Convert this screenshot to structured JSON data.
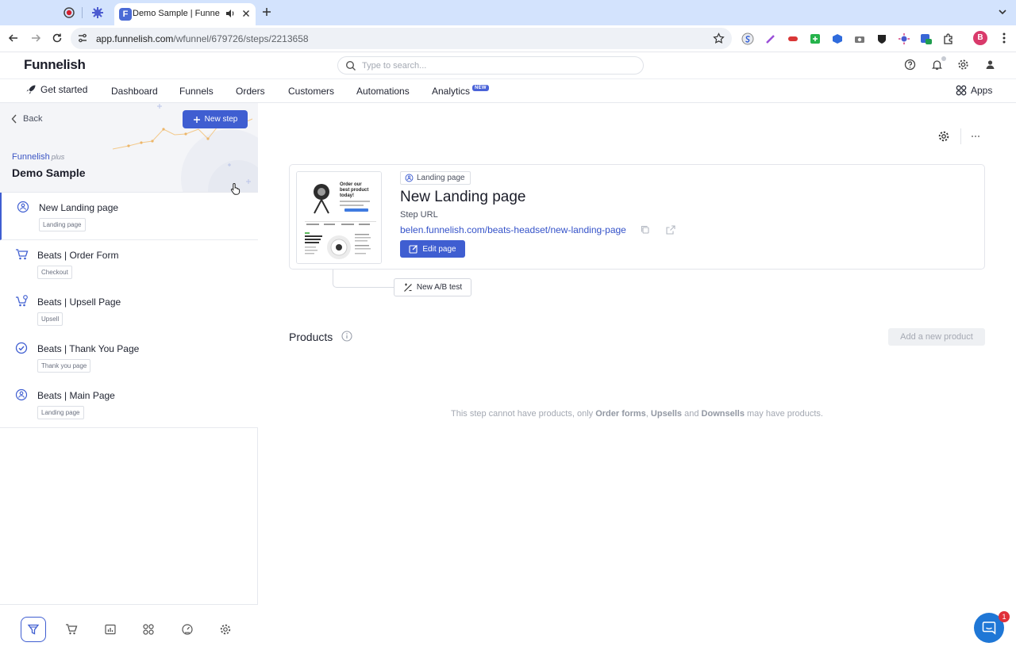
{
  "browser": {
    "active_tab_title": "Demo Sample | Funnelish",
    "url_host": "app.funnelish.com",
    "url_path": "/wfunnel/679726/steps/2213658",
    "profile_initial": "B"
  },
  "header": {
    "logo": "Funnelish",
    "search_placeholder": "Type to search..."
  },
  "nav": {
    "get_started": "Get started",
    "dashboard": "Dashboard",
    "funnels": "Funnels",
    "orders": "Orders",
    "customers": "Customers",
    "automations": "Automations",
    "analytics": "Analytics",
    "analytics_badge": "NEW",
    "apps": "Apps"
  },
  "sidebar": {
    "back": "Back",
    "new_step": "New step",
    "brand": "Funnelish",
    "plan": "plus",
    "funnel_name": "Demo Sample",
    "steps": [
      {
        "title": "New Landing page",
        "tag": "Landing page",
        "icon": "landing-page-icon"
      },
      {
        "title": "Beats | Order Form",
        "tag": "Checkout",
        "icon": "cart-icon"
      },
      {
        "title": "Beats | Upsell Page",
        "tag": "Upsell",
        "icon": "cart-plus-icon"
      },
      {
        "title": "Beats | Thank You Page",
        "tag": "Thank you page",
        "icon": "check-circle-icon"
      },
      {
        "title": "Beats | Main Page",
        "tag": "Landing page",
        "icon": "landing-page-icon"
      }
    ]
  },
  "step_card": {
    "type": "Landing page",
    "title": "New Landing page",
    "url_label": "Step URL",
    "url": "belen.funnelish.com/beats-headset/new-landing-page",
    "edit_button": "Edit page",
    "ab_test_button": "New A/B test",
    "thumb_headline": "Order our best product today!"
  },
  "products": {
    "title": "Products",
    "add_button": "Add a new product",
    "empty_pre": "This step cannot have products, only ",
    "empty_b1": "Order forms",
    "empty_mid1": ", ",
    "empty_b2": "Upsells",
    "empty_mid2": " and ",
    "empty_b3": "Downsells",
    "empty_post": " may have products."
  },
  "chat": {
    "badge": "1"
  },
  "colors": {
    "primary": "#3f5ed1",
    "link": "#3452c9",
    "chat": "#1f77d6"
  }
}
